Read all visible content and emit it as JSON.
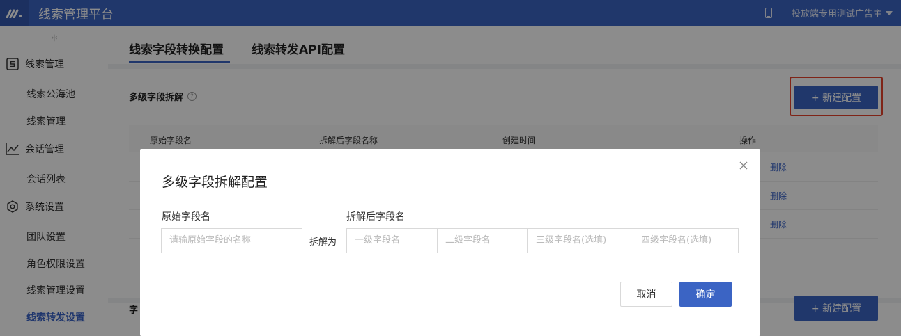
{
  "header": {
    "app_title": "线索管理平台",
    "account_name": "投放端专用测试广告主"
  },
  "sidebar": {
    "collapse_glyph": "›|‹",
    "groups": [
      {
        "label": "线索管理",
        "icon": "s-box-icon",
        "items": [
          "线索公海池",
          "线索管理"
        ]
      },
      {
        "label": "会话管理",
        "icon": "line-chart-icon",
        "items": [
          "会话列表"
        ]
      },
      {
        "label": "系统设置",
        "icon": "gear-icon",
        "items": [
          "团队设置",
          "角色权限设置",
          "线索管理设置",
          "线索转发设置"
        ]
      }
    ],
    "active_item": "线索转发设置"
  },
  "tabs": [
    {
      "label": "线索字段转换配置",
      "active": true
    },
    {
      "label": "线索转发API配置",
      "active": false
    }
  ],
  "section": {
    "title": "多级字段拆解",
    "help_glyph": "?",
    "new_button": "+ 新建配置"
  },
  "table": {
    "columns": [
      "原始字段名",
      "拆解后字段名称",
      "创建时间",
      "操作"
    ],
    "row_actions": [
      "删除",
      "删除",
      "删除"
    ]
  },
  "section2": {
    "title_fragment": "字",
    "new_button": "+ 新建配置"
  },
  "modal": {
    "title": "多级字段拆解配置",
    "label_original": "原始字段名",
    "label_split": "拆解后字段名",
    "split_connector": "拆解为",
    "placeholders": {
      "original": "请输原始字段的名称",
      "level1": "一级字段名",
      "level2": "二级字段名",
      "level3": "三级字段名(选填)",
      "level4": "四级字段名(选填)"
    },
    "cancel_label": "取消",
    "ok_label": "确定"
  },
  "colors": {
    "primary": "#3b64c4",
    "highlight": "#e8432a",
    "active_link": "#3a63c7"
  }
}
